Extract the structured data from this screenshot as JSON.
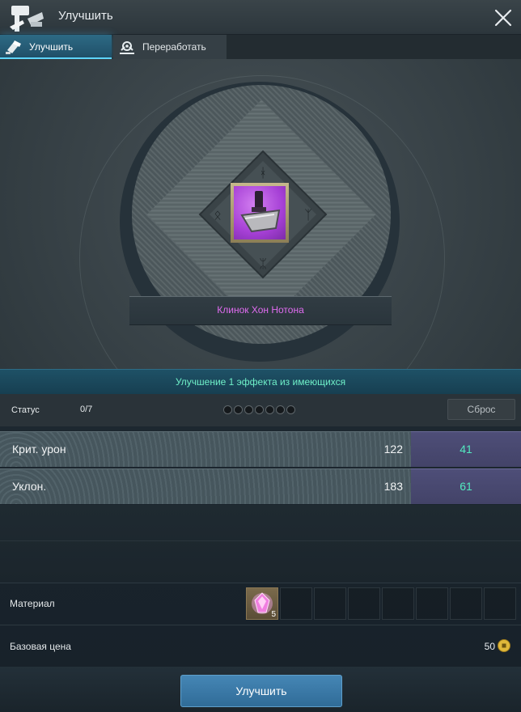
{
  "window": {
    "title": "Улучшить"
  },
  "tabs": [
    {
      "label": "Улучшить",
      "icon": "hammer-icon",
      "active": true
    },
    {
      "label": "Переработать",
      "icon": "recycle-icon",
      "active": false
    }
  ],
  "upgrade": {
    "item_name": "Клинок Хон Нотона",
    "item_name_color": "#e06cf0",
    "info_text": "Улучшение 1 эффекта из имеющихся"
  },
  "status": {
    "label": "Статус",
    "count": "0/7",
    "dots_filled": 0,
    "dots_total": 7,
    "reset_label": "Сброс"
  },
  "stats": [
    {
      "name": "Крит. урон",
      "base": "122",
      "bonus": "41"
    },
    {
      "name": "Уклон.",
      "base": "183",
      "bonus": "61"
    }
  ],
  "material": {
    "label": "Материал",
    "items": [
      {
        "icon": "pink-crystal-icon",
        "quantity": "5"
      }
    ],
    "empty_slots": 7
  },
  "price": {
    "label": "Базовая цена",
    "value": "50",
    "currency_icon": "gold-coin-icon"
  },
  "actions": {
    "upgrade_label": "Улучшить"
  },
  "colors": {
    "accent": "#306c98",
    "bonus": "#53eac0",
    "info": "#6ff0c8"
  }
}
